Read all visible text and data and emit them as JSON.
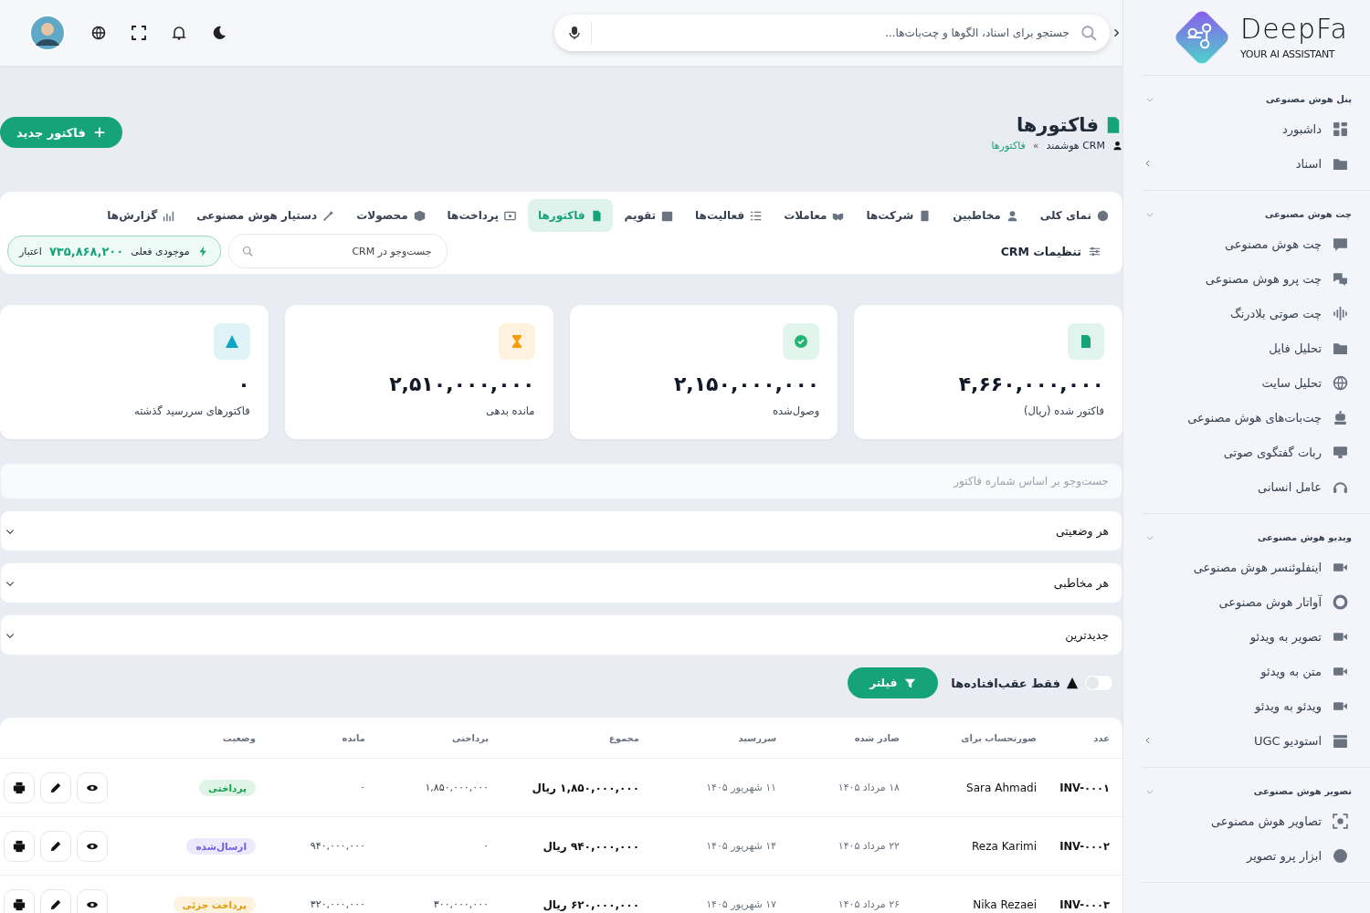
{
  "sidebar": {
    "logo_title": "DeepFa",
    "logo_subtitle": "YOUR AI ASSISTANT",
    "sections": [
      {
        "title": "پنل هوش مصنوعی",
        "expanded": true,
        "items": [
          {
            "label": "داشبورد",
            "has_submenu": false
          },
          {
            "label": "اسناد",
            "has_submenu": true
          }
        ]
      },
      {
        "title": "چت هوش مصنوعی",
        "expanded": true,
        "items": [
          {
            "label": "چت هوش مصنوعی",
            "has_submenu": false
          },
          {
            "label": "چت پرو هوش مصنوعی",
            "has_submenu": false
          },
          {
            "label": "چت صوتی بلادرنگ",
            "has_submenu": false
          },
          {
            "label": "تحلیل فایل",
            "has_submenu": false
          },
          {
            "label": "تحلیل سایت",
            "has_submenu": false
          },
          {
            "label": "چت‌بات‌های هوش مصنوعی",
            "has_submenu": false
          },
          {
            "label": "ربات گفتگوی صوتی",
            "has_submenu": false
          },
          {
            "label": "عامل انسانی",
            "has_submenu": false
          }
        ]
      },
      {
        "title": "ویدیو هوش مصنوعی",
        "expanded": true,
        "items": [
          {
            "label": "اینفلوئنسر هوش مصنوعی",
            "has_submenu": false
          },
          {
            "label": "آواتار هوش مصنوعی",
            "has_submenu": false
          },
          {
            "label": "تصویر به ویدئو",
            "has_submenu": false
          },
          {
            "label": "متن به ویدئو",
            "has_submenu": false
          },
          {
            "label": "ویدئو به ویدئو",
            "has_submenu": false
          },
          {
            "label": "استودیو UGC",
            "has_submenu": true
          }
        ]
      },
      {
        "title": "تصویر هوش مصنوعی",
        "expanded": true,
        "items": [
          {
            "label": "تصاویر هوش مصنوعی",
            "has_submenu": false
          },
          {
            "label": "ابزار پرو تصویر",
            "has_submenu": false
          }
        ]
      }
    ]
  },
  "header": {
    "search_placeholder": "جستجو برای اسناد، الگوها و چت‌بات‌ها..."
  },
  "page": {
    "title": "فاکتورها",
    "breadcrumb": [
      "CRM هوشمند",
      "فاکتورها"
    ],
    "breadcrumb_separator": "»",
    "new_button": "فاکتور جدید"
  },
  "tabs": [
    {
      "label": "نمای کلی",
      "selected": false
    },
    {
      "label": "مخاطبین",
      "selected": false
    },
    {
      "label": "شرکت‌ها",
      "selected": false
    },
    {
      "label": "معاملات",
      "selected": false
    },
    {
      "label": "فعالیت‌ها",
      "selected": false
    },
    {
      "label": "تقویم",
      "selected": false
    },
    {
      "label": "فاکتورها",
      "selected": true
    },
    {
      "label": "پرداخت‌ها",
      "selected": false
    },
    {
      "label": "محصولات",
      "selected": false
    },
    {
      "label": "دستیار هوش مصنوعی",
      "selected": false
    },
    {
      "label": "گزارش‌ها",
      "selected": false
    }
  ],
  "crm_bar": {
    "settings": "تنظیمات CRM",
    "search_placeholder": "جست‌وجو در CRM",
    "balance_label": "موجودی فعلی",
    "balance_value": "۷۳۵,۸۶۸,۲۰۰",
    "balance_unit": "اعتبار"
  },
  "stats": [
    {
      "value": "۴,۶۶۰,۰۰۰,۰۰۰",
      "label": "فاکتور شده (ریال)",
      "color": "#16a37a"
    },
    {
      "value": "۲,۱۵۰,۰۰۰,۰۰۰",
      "label": "وصول‌شده",
      "color": "#22b573"
    },
    {
      "value": "۲,۵۱۰,۰۰۰,۰۰۰",
      "label": "مانده بدهی",
      "color": "#f59e0b"
    },
    {
      "value": "۰",
      "label": "فاکتورهای سررسید گذشته",
      "color": "#0ea5c6"
    }
  ],
  "filters": {
    "search_placeholder": "جست‌وجو بر اساس شماره فاکتور",
    "selects": [
      "هر وضعیتی",
      "هر مخاطبی",
      "جدیدترین"
    ],
    "overdue_toggle": {
      "label": "فقط عقب‌افتاده‌ها",
      "on": false
    },
    "filter_button": "فیلتر"
  },
  "table": {
    "columns": [
      "عدد",
      "صورتحساب برای",
      "صادر شده",
      "سررسید",
      "مجموع",
      "پرداختی",
      "مانده",
      "وضعیت"
    ],
    "rows": [
      {
        "number": "INV-۰۰۰۱",
        "client": "Sara Ahmadi",
        "issued": "۱۸ مرداد ۱۴۰۵",
        "due": "۱۱ شهریور ۱۴۰۵",
        "total": "۱,۸۵۰,۰۰۰,۰۰۰ ریال",
        "paid": "۱,۸۵۰,۰۰۰,۰۰۰",
        "balance": "۰",
        "status": "پرداختی",
        "color": "#16a34a"
      },
      {
        "number": "INV-۰۰۰۲",
        "client": "Reza Karimi",
        "issued": "۲۲ مرداد ۱۴۰۵",
        "due": "۱۴ شهریور ۱۴۰۵",
        "total": "۹۴۰,۰۰۰,۰۰۰ ریال",
        "paid": "۰",
        "balance": "۹۴۰,۰۰۰,۰۰۰",
        "status": "ارسال‌شده",
        "color": "#6d5ce8"
      },
      {
        "number": "INV-۰۰۰۳",
        "client": "Nika Rezaei",
        "issued": "۲۶ مرداد ۱۴۰۵",
        "due": "۱۷ شهریور ۱۴۰۵",
        "total": "۶۲۰,۰۰۰,۰۰۰ ریال",
        "paid": "۳۰۰,۰۰۰,۰۰۰",
        "balance": "۳۲۰,۰۰۰,۰۰۰",
        "status": "پرداخت جزئی",
        "color": "#e59a0b"
      }
    ]
  }
}
